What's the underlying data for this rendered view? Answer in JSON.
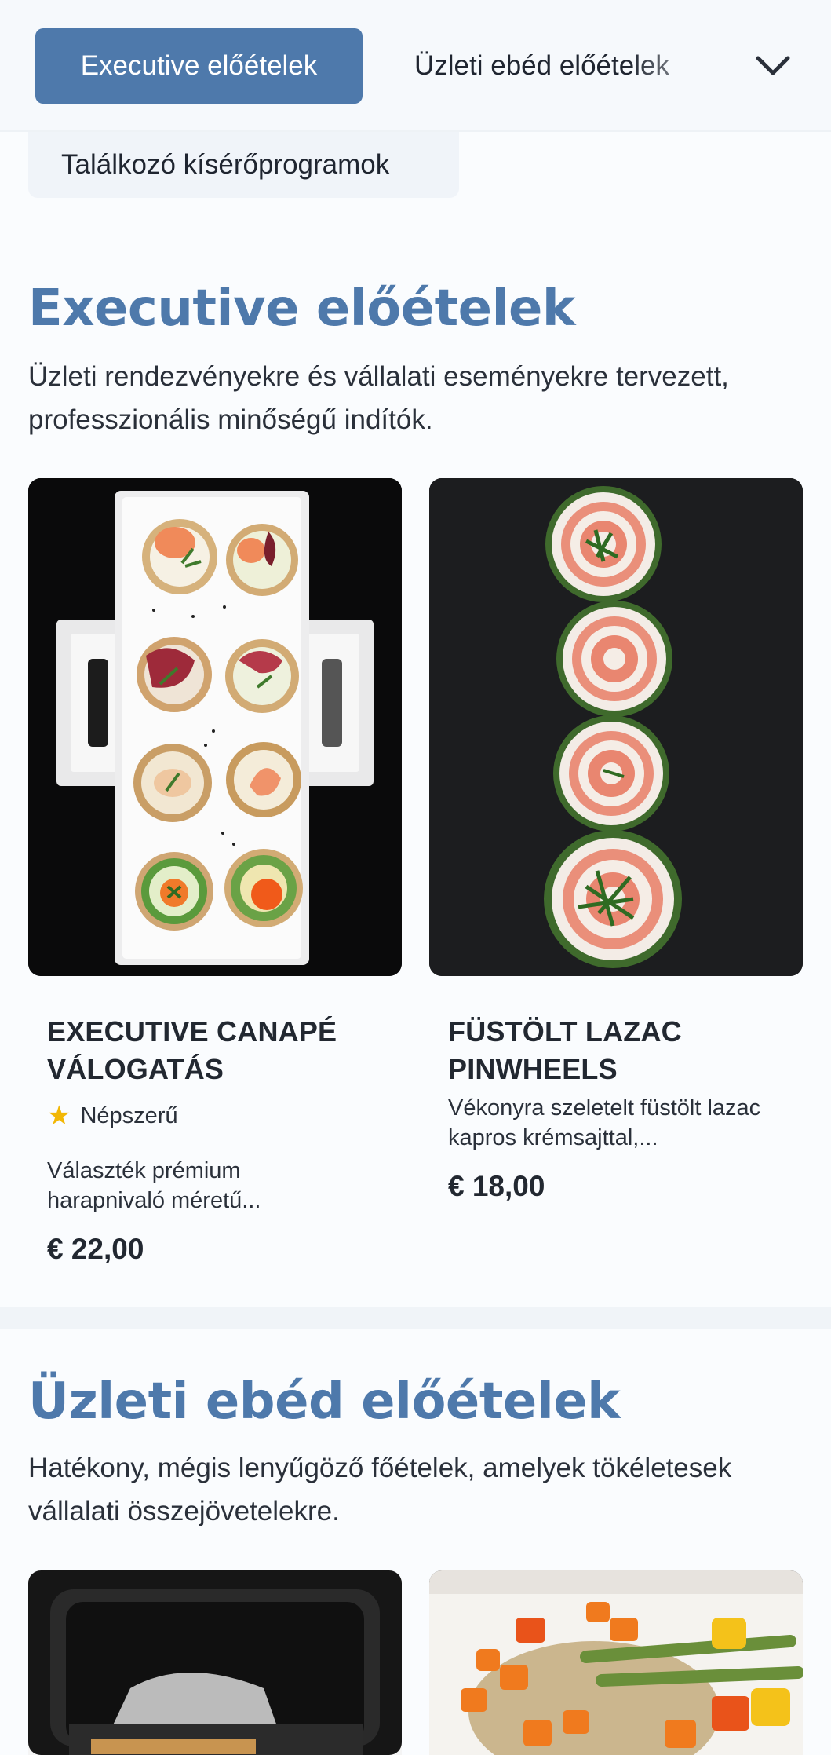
{
  "nav": {
    "tabs": [
      {
        "label": "Executive előételek",
        "active": true
      },
      {
        "label": "Üzleti ebéd előételek",
        "active": false
      },
      {
        "label": "Találkozó kísérőprogramok",
        "active": false
      }
    ],
    "dropdown_icon": "chevron-down-icon"
  },
  "sections": [
    {
      "title": "Executive előételek",
      "description": "Üzleti rendezvényekre és vállalati eseményekre tervezett, professzionális minőségű indítók.",
      "items": [
        {
          "name": "EXECUTIVE CANAPÉ VÁLOGATÁS",
          "badge": "Népszerű",
          "badge_icon": "star-icon",
          "description": "Választék prémium harapnivaló méretű...",
          "price": "€ 22,00"
        },
        {
          "name": "FÜSTÖLT LAZAC PINWHEELS",
          "description": "Vékonyra szeletelt füstölt lazac kapros krémsajttal,...",
          "price": "€ 18,00"
        }
      ]
    },
    {
      "title": "Üzleti ebéd előételek",
      "description": "Hatékony, mégis lenyűgöző főételek, amelyek tökéletesek vállalati összejövetelekre."
    }
  ],
  "colors": {
    "accent": "#4e79ab",
    "star": "#f2b705",
    "background": "#fafcfe"
  }
}
